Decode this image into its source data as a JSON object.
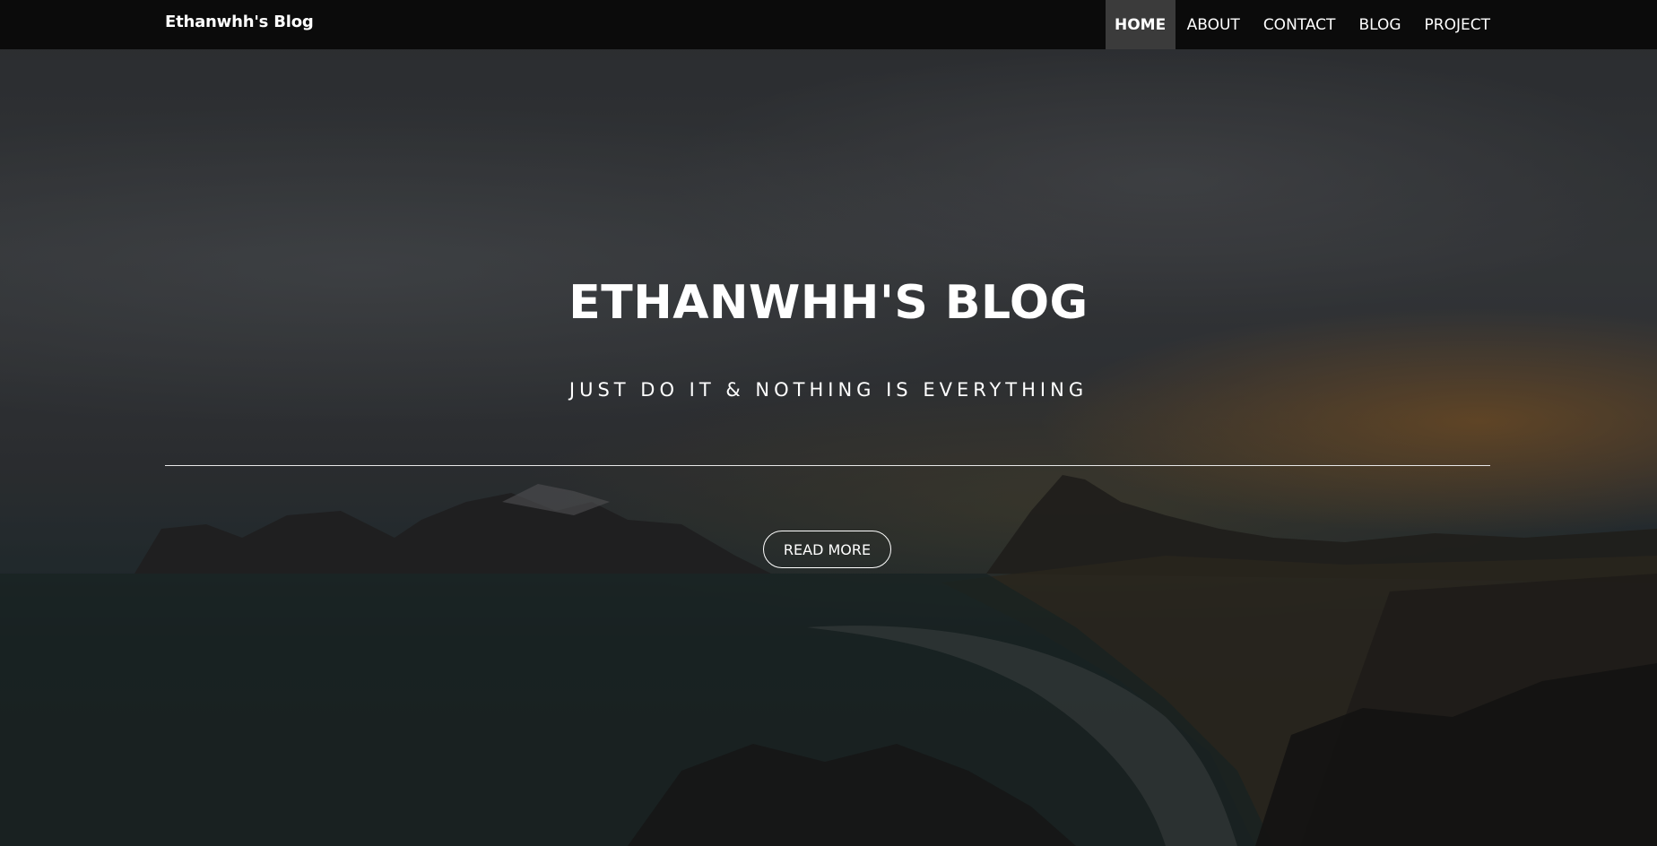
{
  "navbar": {
    "brand": "Ethanwhh's Blog",
    "items": [
      {
        "label": "HOME",
        "active": true
      },
      {
        "label": "ABOUT",
        "active": false
      },
      {
        "label": "CONTACT",
        "active": false
      },
      {
        "label": "BLOG",
        "active": false
      },
      {
        "label": "PROJECT",
        "active": false
      }
    ]
  },
  "hero": {
    "title": "ETHANWHH'S BLOG",
    "subtitle": "JUST DO IT & NOTHING IS EVERYTHING",
    "button_label": "READ MORE"
  },
  "colors": {
    "navbar_bg": "#0b0b0b",
    "nav_active_bg": "#3b3b3b",
    "text": "#ffffff"
  }
}
